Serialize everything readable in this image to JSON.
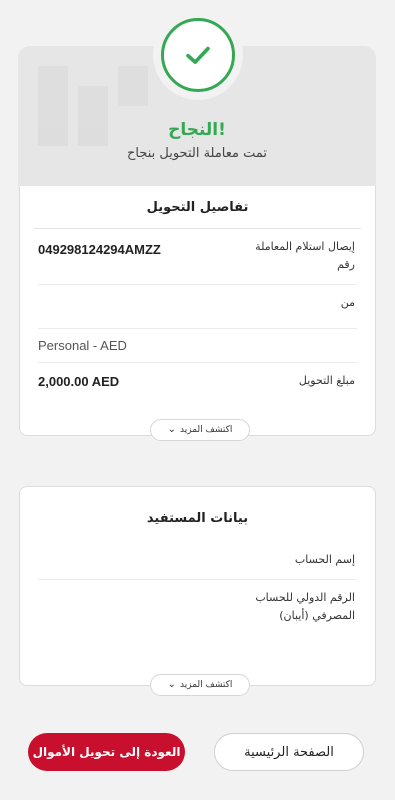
{
  "status": {
    "title": "النجاح!",
    "subtitle": "تمت معاملة التحويل بنجاح"
  },
  "transfer_details": {
    "heading": "تفاصيل التحويل",
    "rows": [
      {
        "label": "إيصال استلام المعاملة رقم",
        "value": "049298124294AMZZ"
      },
      {
        "label": "من",
        "value": ""
      },
      {
        "label": "",
        "value": "Personal - AED"
      },
      {
        "label": "مبلغ التحويل",
        "value": "2,000.00 AED"
      }
    ],
    "more_label": "اكتشف المزيد"
  },
  "beneficiary": {
    "heading": "بيانات المستفيد",
    "rows": [
      {
        "label": "إسم الحساب",
        "value": ""
      },
      {
        "label": "الرقم الدولي للحساب المصرفي (أيبان)",
        "value": ""
      }
    ],
    "more_label": "اكتشف المزيد"
  },
  "actions": {
    "home": "الصفحة الرئيسية",
    "back": "العودة إلى تحويل الأموال"
  },
  "colors": {
    "success": "#34a853",
    "primary": "#c8102e"
  },
  "icons": {
    "status": "check-icon",
    "expand": "chevron-down-icon"
  }
}
